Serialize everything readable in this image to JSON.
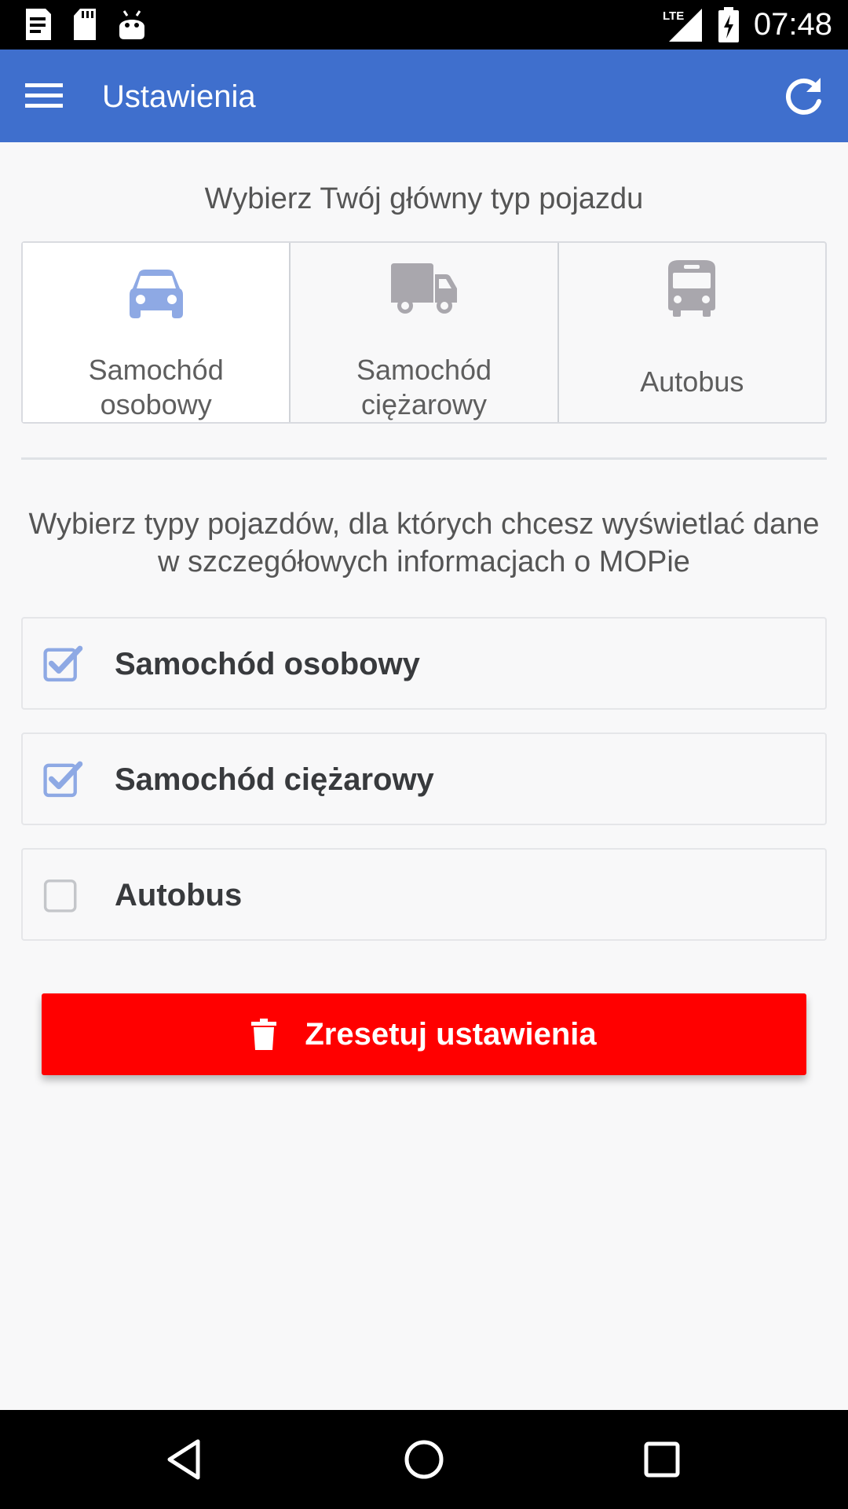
{
  "status_bar": {
    "time": "07:48",
    "network": "LTE",
    "icons": [
      "notes-icon",
      "sd-card-icon",
      "android-icon",
      "lte-signal-icon",
      "battery-charging-icon"
    ]
  },
  "app_bar": {
    "title": "Ustawienia",
    "menu_icon": "hamburger-menu-icon",
    "refresh_icon": "refresh-icon",
    "background_color": "#3f6fcd"
  },
  "vehicle_section": {
    "heading": "Wybierz Twój główny typ pojazdu",
    "options": [
      {
        "label_line1": "Samochód",
        "label_line2": "osobowy",
        "icon": "car-icon",
        "selected": true
      },
      {
        "label_line1": "Samochód",
        "label_line2": "ciężarowy",
        "icon": "truck-icon",
        "selected": false
      },
      {
        "label": "Autobus",
        "icon": "bus-icon",
        "selected": false
      }
    ],
    "selected_color": "#8ea9e4",
    "unselected_color": "#a9a7ad"
  },
  "details_section": {
    "heading": "Wybierz typy pojazdów, dla których chcesz wyświetlać dane w szczegółowych informacjach o MOPie",
    "items": [
      {
        "label": "Samochód osobowy",
        "checked": true
      },
      {
        "label": "Samochód ciężarowy",
        "checked": true
      },
      {
        "label": "Autobus",
        "checked": false
      }
    ],
    "check_color": "#8ea9e4"
  },
  "reset_button": {
    "label": "Zresetuj ustawienia",
    "icon": "trash-icon",
    "color": "#ff0000"
  },
  "nav_bar": {
    "buttons": [
      "back-icon",
      "home-icon",
      "recent-apps-icon"
    ]
  }
}
